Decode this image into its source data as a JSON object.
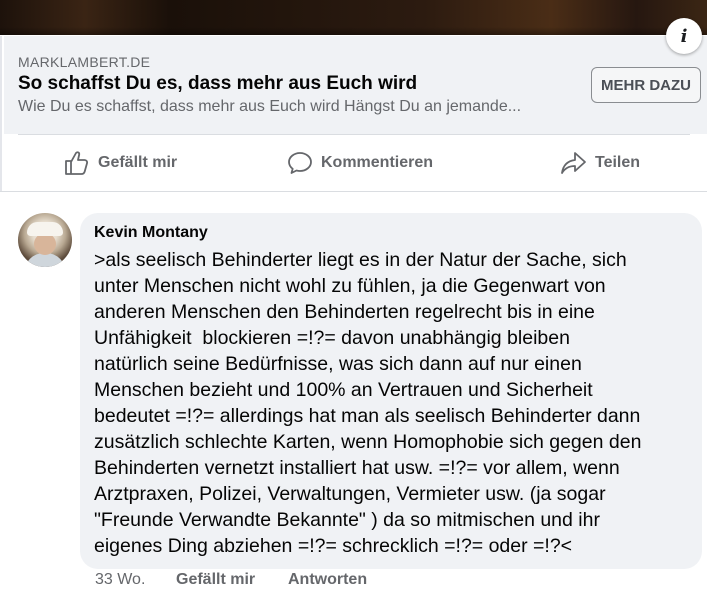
{
  "post": {
    "link": {
      "domain": "MARKLAMBERT.DE",
      "title": "So schaffst Du es, dass mehr aus Euch wird",
      "description": "Wie Du es schaffst, dass mehr aus Euch wird Hängst Du an jemande...",
      "cta_label": "MEHR DAZU",
      "info_icon": "info-icon"
    },
    "actions": [
      {
        "label": "Gefällt mir",
        "icon": "thumbs-up-icon"
      },
      {
        "label": "Kommentieren",
        "icon": "comment-icon"
      },
      {
        "label": "Teilen",
        "icon": "share-icon"
      }
    ]
  },
  "comment": {
    "author": "Kevin Montany",
    "lines": [
      ">als seelisch Behinderter liegt es in der Natur der Sache, sich",
      "unter Menschen nicht wohl zu fühlen, ja die Gegenwart von",
      "anderen Menschen den Behinderten regelrecht bis in eine",
      "Unfähigkeit  blockieren =!?= davon unabhängig bleiben",
      "natürlich seine Bedürfnisse, was sich dann auf nur einen",
      "Menschen bezieht und 100% an Vertrauen und Sicherheit",
      "bedeutet =!?= allerdings hat man als seelisch Behinderter dann",
      "zusätzlich schlechte Karten, wenn Homophobie sich gegen den",
      "Behinderten vernetzt installiert hat usw. =!?= vor allem, wenn",
      "Arztpraxen, Polizei, Verwaltungen, Vermieter usw. (ja sogar",
      "\"Freunde Verwandte Bekannte\" ) da so mitmischen und ihr",
      "eigenes Ding abziehen =!?= schrecklich =!?= oder =!?<"
    ],
    "time": "33 Wo.",
    "like_label": "Gefällt mir",
    "reply_label": "Antworten"
  },
  "colors": {
    "secondary_text": "#65676b",
    "card_background": "#f0f2f5",
    "primary_text": "#050505"
  }
}
